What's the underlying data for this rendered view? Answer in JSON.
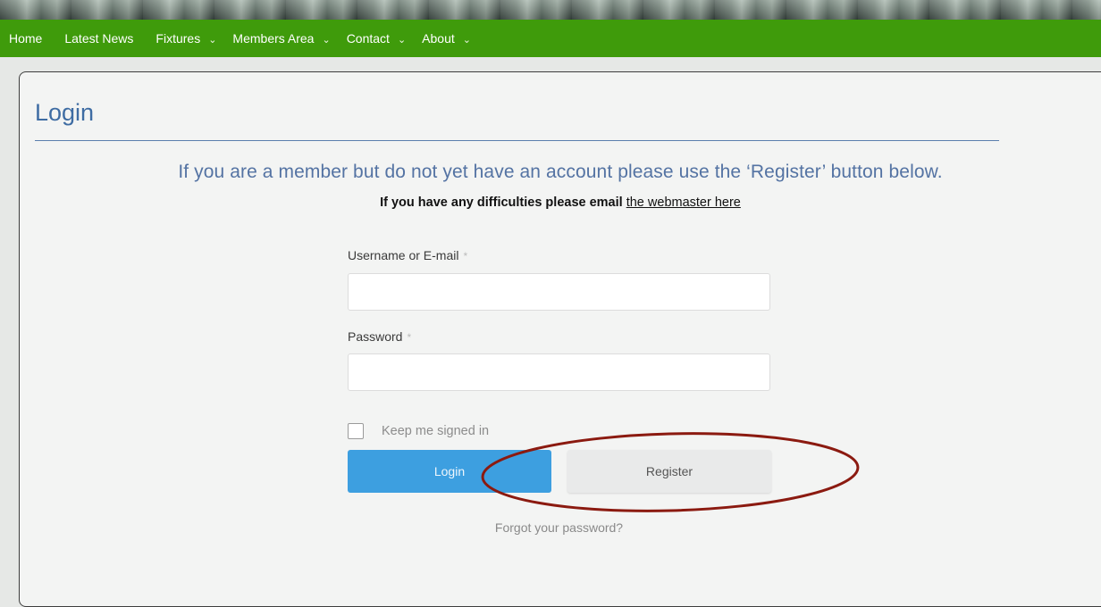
{
  "nav": {
    "items": [
      {
        "label": "Home",
        "dropdown": false
      },
      {
        "label": "Latest News",
        "dropdown": false
      },
      {
        "label": "Fixtures",
        "dropdown": true
      },
      {
        "label": "Members Area",
        "dropdown": true
      },
      {
        "label": "Contact",
        "dropdown": true
      },
      {
        "label": "About",
        "dropdown": true
      }
    ],
    "chevron": "⌄"
  },
  "page": {
    "title": "Login",
    "lead": "If you are a member but do not yet have an account please use the ‘Register’ button below.",
    "difficulty_text": "If you have any difficulties please email",
    "webmaster_link": "the webmaster here"
  },
  "form": {
    "username_label": "Username or E-mail",
    "password_label": "Password",
    "required_mark": "*",
    "username_value": "",
    "password_value": "",
    "keep_signed_in_label": "Keep me signed in",
    "keep_signed_in_checked": false,
    "login_label": "Login",
    "register_label": "Register",
    "forgot_label": "Forgot your password?"
  },
  "colors": {
    "nav_bg": "#3f9b0b",
    "title": "#3e6ca3",
    "login_button": "#3d9fe0",
    "annotation": "#8b1a10"
  }
}
